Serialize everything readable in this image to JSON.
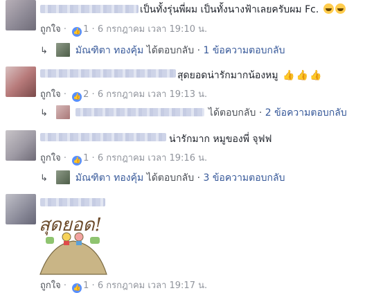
{
  "comments": [
    {
      "text": "เป็นทั้งรุ่นพี่ผม เป็นทั้งนางฟ้าเลยครับผม Fc.",
      "like_label": "ถูกใจ",
      "like_count": "1",
      "timestamp": "6 กรกฎาคม เวลา 19:10 น.",
      "reply": {
        "author": "มัณฑิตา ทองคุ้ม",
        "action": "ได้ตอบกลับ",
        "count_text": "1 ข้อความตอบกลับ"
      }
    },
    {
      "text": "สุดยอดน่ารักมากน้องหมู",
      "like_label": "ถูกใจ",
      "like_count": "2",
      "timestamp": "6 กรกฎาคม เวลา 19:13 น.",
      "reply": {
        "author": "",
        "action": "ได้ตอบกลับ",
        "count_text": "2 ข้อความตอบกลับ"
      }
    },
    {
      "text": "น่ารักมาก หมูของพี่ จุฟฟ",
      "like_label": "ถูกใจ",
      "like_count": "1",
      "timestamp": "6 กรกฎาคม เวลา 19:16 น.",
      "reply": {
        "author": "มัณฑิตา ทองคุ้ม",
        "action": "ได้ตอบกลับ",
        "count_text": "3 ข้อความตอบกลับ"
      }
    },
    {
      "sticker_text": "สุดยอด!",
      "like_label": "ถูกใจ",
      "like_count": "1",
      "timestamp": "6 กรกฎาคม เวลา 19:17 น."
    }
  ],
  "colors": {
    "link": "#365899",
    "meta": "#90949c",
    "like_badge": "#5890ff"
  },
  "icons": [
    "thumbs-up-icon",
    "reply-arrow-icon",
    "grinning-emoji-icon",
    "thumbs-up-emoji-icon"
  ]
}
